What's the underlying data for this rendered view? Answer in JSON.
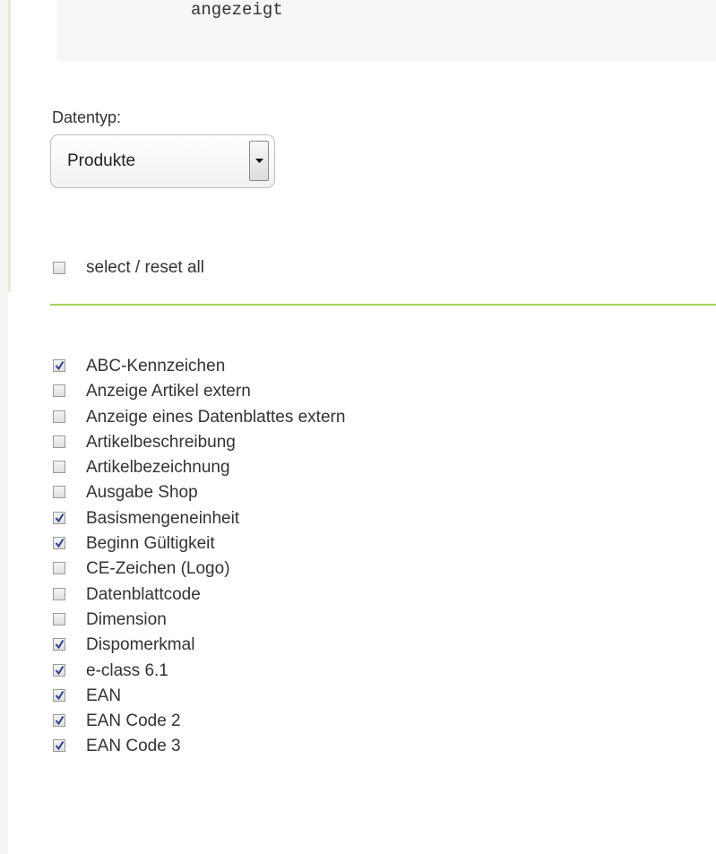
{
  "code_block": {
    "text": "angezeigt"
  },
  "datentyp": {
    "label": "Datentyp:",
    "selected": "Produkte"
  },
  "select_all": {
    "label": "select / reset all",
    "checked": false
  },
  "fields": [
    {
      "label": "ABC-Kennzeichen",
      "checked": true
    },
    {
      "label": "Anzeige Artikel extern",
      "checked": false
    },
    {
      "label": "Anzeige eines Datenblattes extern",
      "checked": false
    },
    {
      "label": "Artikelbeschreibung",
      "checked": false
    },
    {
      "label": "Artikelbezeichnung",
      "checked": false
    },
    {
      "label": "Ausgabe Shop",
      "checked": false
    },
    {
      "label": "Basismengeneinheit",
      "checked": true
    },
    {
      "label": "Beginn Gültigkeit",
      "checked": true
    },
    {
      "label": "CE-Zeichen (Logo)",
      "checked": false
    },
    {
      "label": "Datenblattcode",
      "checked": false
    },
    {
      "label": "Dimension",
      "checked": false
    },
    {
      "label": "Dispomerkmal",
      "checked": true
    },
    {
      "label": "e-class 6.1",
      "checked": true
    },
    {
      "label": "EAN",
      "checked": true
    },
    {
      "label": "EAN Code 2",
      "checked": true
    },
    {
      "label": "EAN Code 3",
      "checked": true
    }
  ],
  "colors": {
    "divider": "#a6d35a",
    "checkmark": "#2a3f8f"
  }
}
